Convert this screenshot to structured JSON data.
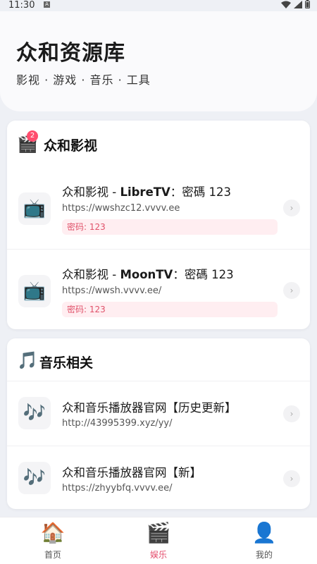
{
  "status_bar": {
    "time": "11:30",
    "notif_icon": "A"
  },
  "header": {
    "title": "众和资源库",
    "subtitle": "影视 · 游戏 · 音乐 · 工具"
  },
  "sections": [
    {
      "title": "众和影视",
      "icon": "clapper-icon",
      "badge": "2",
      "items": [
        {
          "name_prefix": "众和影视 - ",
          "name_bold": "LibreTV",
          "name_suffix": "：密碼 123",
          "url": "https://wwshzc12.vvvv.ee",
          "password": "密码: 123"
        },
        {
          "name_prefix": "众和影视 - ",
          "name_bold": "MoonTV",
          "name_suffix": "：密碼 123",
          "url": "https://wwsh.vvvv.ee/",
          "password": "密码: 123"
        }
      ]
    },
    {
      "title": "音乐相关",
      "icon": "music-note-icon",
      "items": [
        {
          "name": "众和音乐播放器官网【历史更新】",
          "url": "http://43995399.xyz/yy/"
        },
        {
          "name": "众和音乐播放器官网【新】",
          "url": "https://zhyybfq.vvvv.ee/"
        }
      ]
    }
  ],
  "tabs": [
    {
      "label": "首页",
      "icon": "house-icon"
    },
    {
      "label": "娱乐",
      "icon": "clapper-icon",
      "active": true
    },
    {
      "label": "我的",
      "icon": "user-icon"
    }
  ],
  "colors": {
    "accent": "#e44b6b",
    "badge": "#ff4d6d",
    "password_bg": "#ffeef1"
  }
}
